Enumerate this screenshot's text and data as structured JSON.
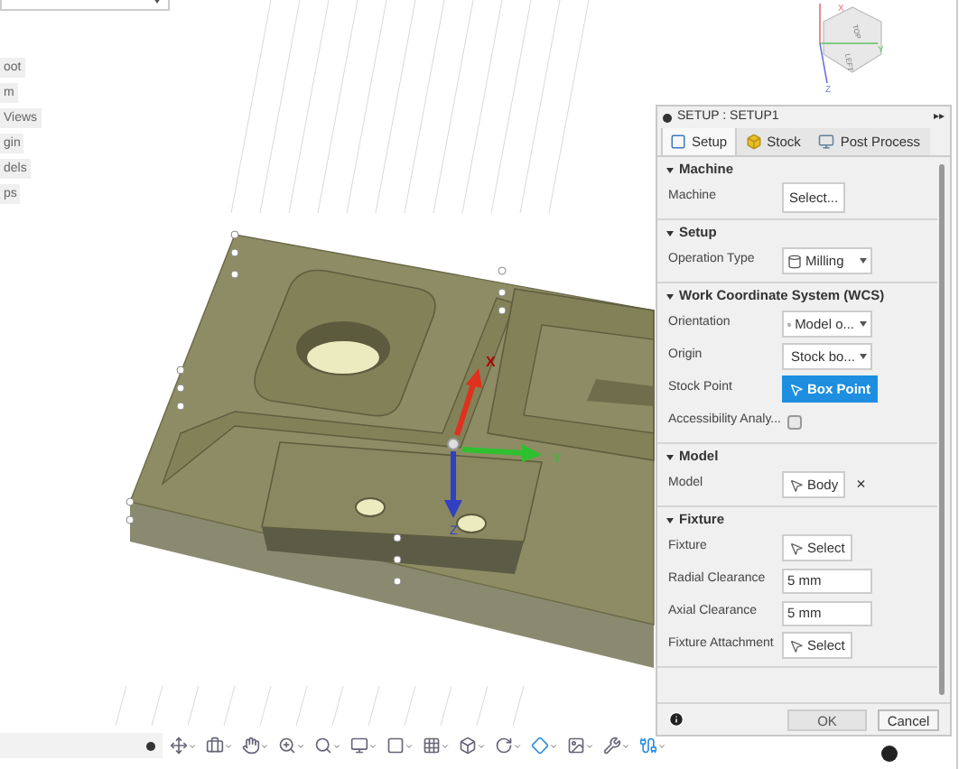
{
  "browser": {
    "items": [
      "oot",
      "m",
      "Views",
      "gin",
      "dels",
      "ps"
    ]
  },
  "viewcube": {
    "faces": [
      "TOP",
      "LEFT"
    ],
    "axes": [
      "X",
      "Y",
      "Z"
    ]
  },
  "triad": {
    "axes": [
      "X",
      "Y",
      "Z"
    ]
  },
  "panel": {
    "title": "SETUP : SETUP1",
    "collapse": "▸▸",
    "tabs": [
      {
        "label": "Setup",
        "selected": true
      },
      {
        "label": "Stock",
        "selected": false
      },
      {
        "label": "Post Process",
        "selected": false
      }
    ],
    "sections": [
      {
        "title": "Machine",
        "expanded": true,
        "rows": [
          {
            "kind": "button",
            "label": "Machine",
            "value": "Select..."
          }
        ]
      },
      {
        "title": "Setup",
        "expanded": true,
        "rows": [
          {
            "kind": "dropdown",
            "label": "Operation Type",
            "value": "Milling"
          }
        ]
      },
      {
        "title": "Work Coordinate System (WCS)",
        "expanded": true,
        "rows": [
          {
            "kind": "dropdown",
            "label": "Orientation",
            "value": "Model o..."
          },
          {
            "kind": "dropdown",
            "label": "Origin",
            "value": "Stock bo..."
          },
          {
            "kind": "pick",
            "label": "Stock Point",
            "value": "Box Point",
            "active": true
          },
          {
            "kind": "checkbox",
            "label": "Accessibility Analy...",
            "checked": false
          }
        ]
      },
      {
        "title": "Model",
        "expanded": true,
        "rows": [
          {
            "kind": "pick",
            "label": "Model",
            "value": "Body",
            "active": false,
            "clear": "×"
          }
        ]
      },
      {
        "title": "Fixture",
        "expanded": true,
        "rows": [
          {
            "kind": "pick",
            "label": "Fixture",
            "value": "Select",
            "active": false
          },
          {
            "kind": "input",
            "label": "Radial Clearance",
            "value": "5 mm"
          },
          {
            "kind": "input",
            "label": "Axial Clearance",
            "value": "5 mm"
          },
          {
            "kind": "pick",
            "label": "Fixture Attachment",
            "value": "Select",
            "active": false
          }
        ]
      }
    ],
    "buttons": [
      {
        "label": "OK",
        "primary": true
      },
      {
        "label": "Cancel",
        "primary": false
      }
    ]
  }
}
